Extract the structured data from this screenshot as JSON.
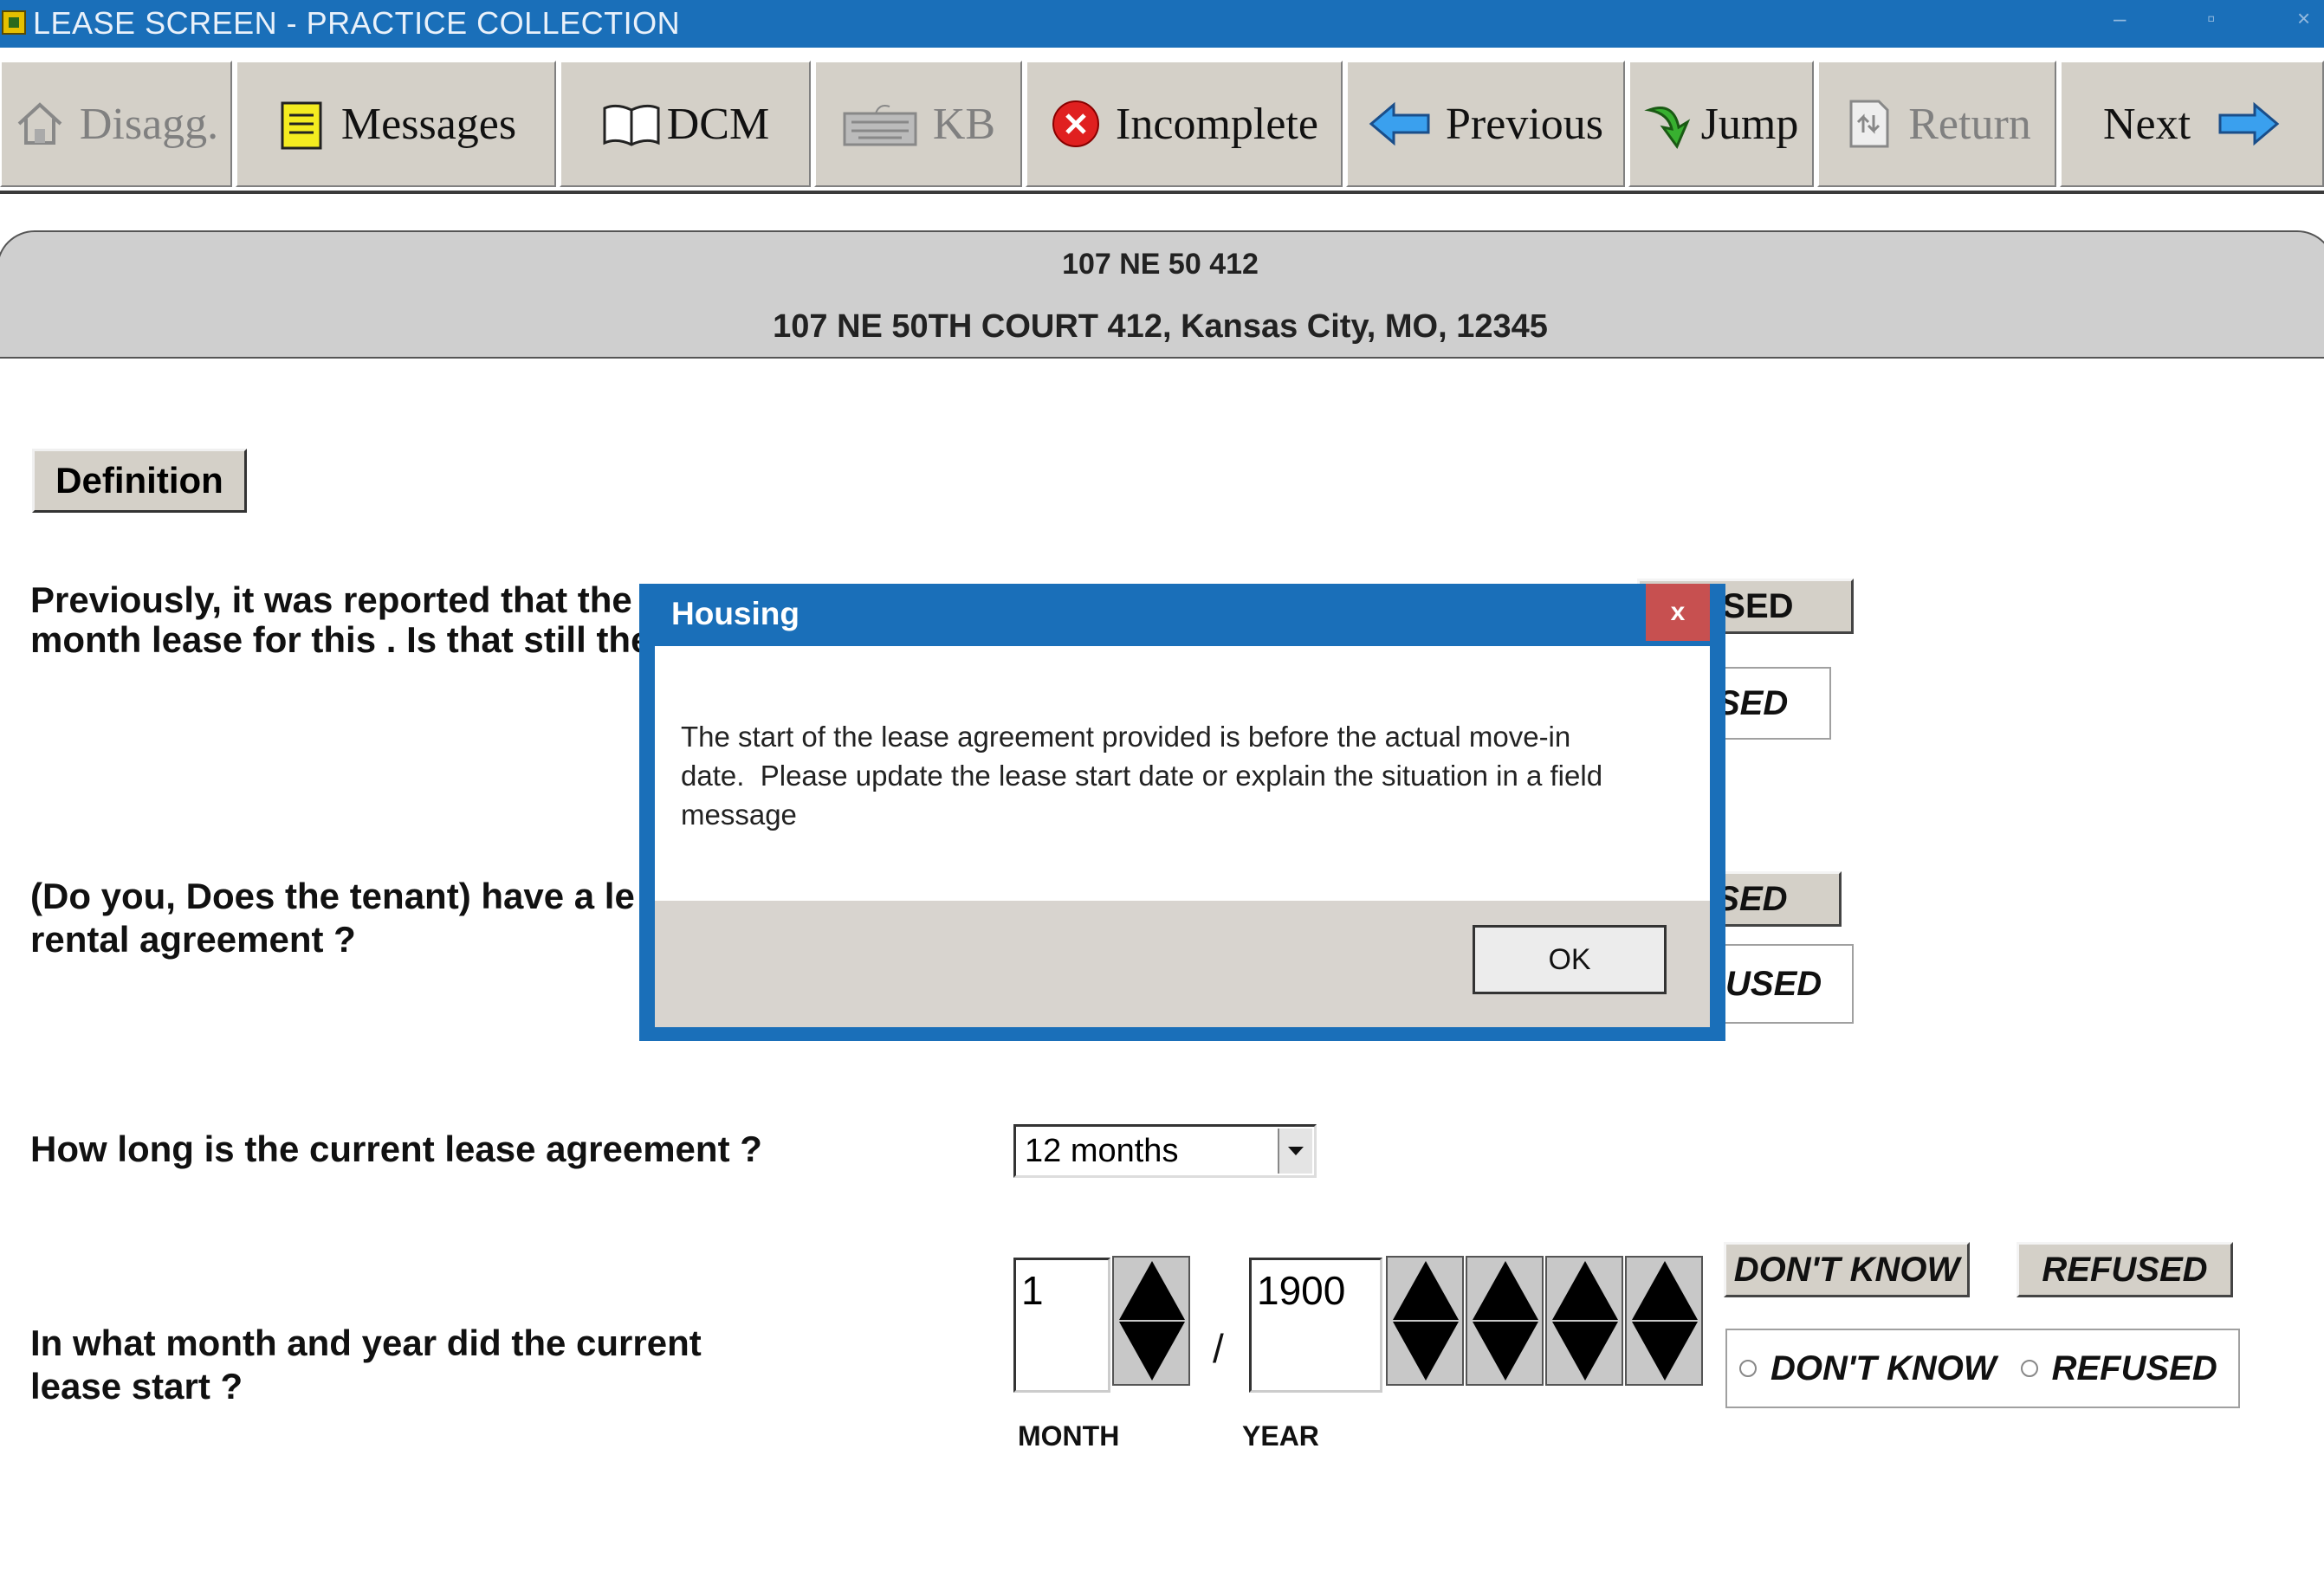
{
  "window": {
    "title": "LEASE SCREEN - PRACTICE COLLECTION",
    "minimize": "–",
    "maximize": "▫",
    "close": "×"
  },
  "toolbar": {
    "disagg": "Disagg.",
    "messages": "Messages",
    "dcm": "DCM",
    "kb": "KB",
    "incomplete": "Incomplete",
    "previous": "Previous",
    "jump": "Jump",
    "return": "Return",
    "next": "Next"
  },
  "address": {
    "code": "107 NE 50 412",
    "full": "107 NE 50TH COURT 412, Kansas City, MO, 12345"
  },
  "definition_button": "Definition",
  "questions": {
    "q1_line1": "Previously, it was reported that the",
    "q1_line2": "month lease for this . Is that still the",
    "q1_refused_btn": "USED",
    "q1_refused_opt": "SED",
    "q2_line1": "(Do you, Does the tenant) have a le",
    "q2_line2": "rental agreement ?",
    "q2_refused_btn": "USED",
    "q2_refused_opt": "USED",
    "q3": "How long is the current lease agreement ?",
    "q3_value": "12 months",
    "q4_line1": "In what month and year did the current",
    "q4_line2": "lease start ?",
    "month_value": "1",
    "year_value": "1900",
    "separator": "/",
    "month_label": "MONTH",
    "year_label": "YEAR",
    "dont_know_btn": "DON'T KNOW",
    "refused_btn": "REFUSED",
    "dont_know_opt": "DON'T KNOW",
    "refused_opt": "REFUSED"
  },
  "dialog": {
    "title": "Housing",
    "close": "x",
    "message_line1": "The start of the lease agreement provided is before the actual move-in",
    "message_line2": "date.  Please update the lease start date or explain the situation in a field",
    "message_line3": "message",
    "ok": "OK"
  },
  "colors": {
    "titlebar": "#1a6fb9",
    "dialog_close": "#c75050",
    "toolbar_face": "#d4d0c8"
  }
}
